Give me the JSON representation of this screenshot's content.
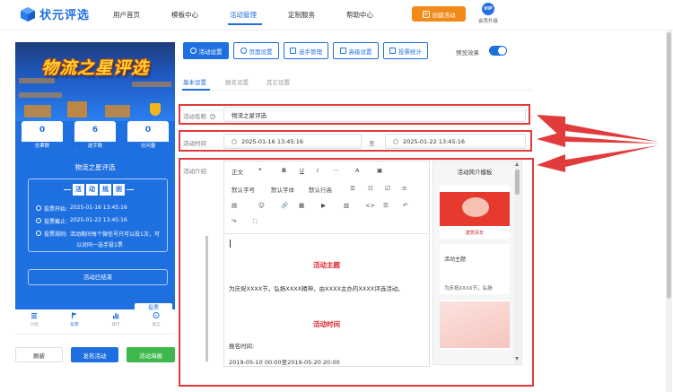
{
  "brand": {
    "name": "状元评选"
  },
  "nav": {
    "items": [
      "用户首页",
      "模板中心",
      "活动管理",
      "定制服务",
      "帮助中心"
    ],
    "active": "活动管理"
  },
  "header": {
    "create_button": "创建活动",
    "vip_badge": "VIP",
    "vip_label": "会员升级"
  },
  "preview": {
    "banner_title": "物流之星评选",
    "stats": [
      {
        "value": "0",
        "label": "总票数"
      },
      {
        "value": "6",
        "label": "选手数"
      },
      {
        "value": "0",
        "label": "访问量"
      }
    ],
    "title": "物流之星评选",
    "rules_tags": [
      "活",
      "动",
      "规",
      "则"
    ],
    "rules": [
      {
        "label": "投票开始:",
        "value": "2025-01-16 13:45:16"
      },
      {
        "label": "投票截止:",
        "value": "2025-01-22 13:45:16"
      },
      {
        "label": "投票规则:",
        "value": "活动期间每个微信号只可以投1次，可"
      }
    ],
    "rules_line2": "以对同一选手投1票",
    "ended_label": "活动已结束",
    "vote_button": "投票",
    "tabbar": [
      {
        "label": "介绍",
        "icon": "list-icon"
      },
      {
        "label": "投票",
        "icon": "flag-icon"
      },
      {
        "label": "排行",
        "icon": "bar-chart-icon"
      },
      {
        "label": "留言",
        "icon": "message-icon"
      }
    ],
    "tabbar_active": "投票"
  },
  "bottom_buttons": {
    "refresh": "刷新",
    "publish": "发布活动",
    "share": "活动海报"
  },
  "toolbar": {
    "buttons": [
      "活动设置",
      "页面设置",
      "选手管理",
      "高级设置",
      "投票统计"
    ],
    "active": "活动设置",
    "preview_label": "预览效果",
    "preview_on": true
  },
  "subtabs": {
    "items": [
      "基本设置",
      "报名设置",
      "其它设置"
    ],
    "active": "基本设置"
  },
  "form": {
    "name_label": "活动名称",
    "name_value": "物流之星评选",
    "time_label": "活动时间",
    "start": "2025-01-16 13:45:16",
    "separator": "至",
    "end": "2025-01-22 13:45:16",
    "intro_label": "活动介绍"
  },
  "editor": {
    "toolbar_row1": [
      "正文",
      "❝",
      "B",
      "U",
      "I",
      "⋯",
      "A",
      "▣"
    ],
    "toolbar_row2": [
      "默认字号",
      "默认字体",
      "默认行高",
      "☰",
      "☷",
      "☑",
      "≡"
    ],
    "toolbar_row3": [
      "▤",
      "☺",
      "🔗",
      "▦",
      "▶",
      "▥",
      "<>",
      "☰",
      "↶"
    ],
    "toolbar_row4": [
      "↷",
      "⛶"
    ],
    "heading1": "活动主题",
    "paragraph1": "为庆祝XXXX节，弘扬XXXX精神，由XXXX主办的XXXX评选活动。",
    "heading2": "活动时间",
    "paragraph2": "报名时间:",
    "paragraph3": "2019-05-10 00:00至2019-05-20 20:00"
  },
  "template_panel": {
    "title": "活动简介模板",
    "card2_title": "活动主题",
    "card2_text": "为庆祝XXXX节，弘扬",
    "card1_caption": "建党百年"
  },
  "colors": {
    "accent": "#1e6fe0",
    "orange": "#f28a1a",
    "green": "#3cb94a",
    "highlight": "#e23b3b"
  }
}
